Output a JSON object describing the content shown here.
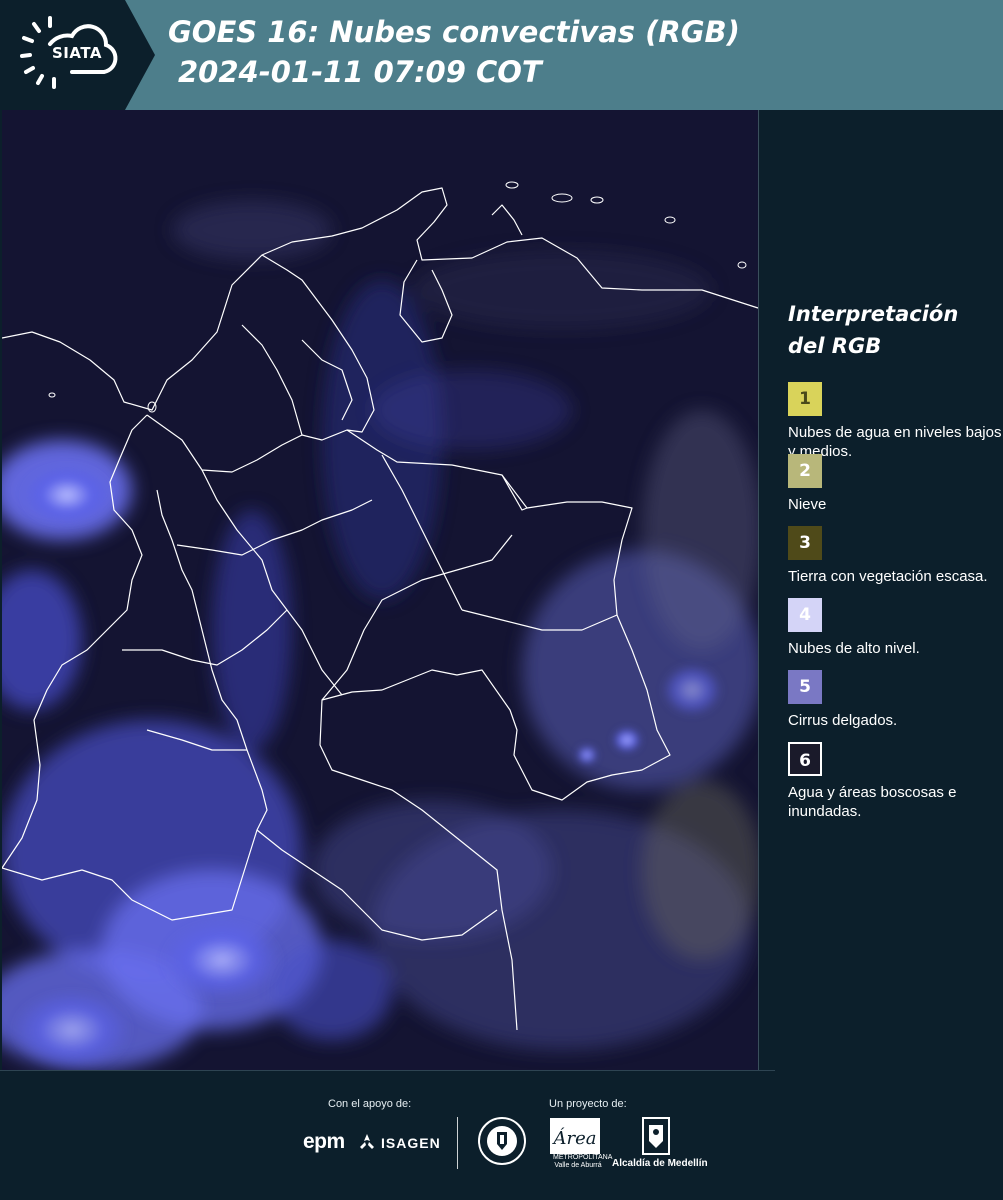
{
  "header": {
    "logo_text": "SIATA",
    "title_line1": "GOES 16: Nubes convectivas (RGB)",
    "title_line2": "2024-01-11 07:09 COT"
  },
  "legend": {
    "title_line1": "Interpretación",
    "title_line2": "del RGB",
    "items": [
      {
        "number": "1",
        "label": "Nubes de agua en niveles bajos y medios.",
        "color": "#d9d35a",
        "text_color": "#4a4a1a"
      },
      {
        "number": "2",
        "label": "Nieve",
        "color": "#b8b77a",
        "text_color": "#ffffff"
      },
      {
        "number": "3",
        "label": "Tierra con vegetación escasa.",
        "color": "#4f4a19",
        "text_color": "#ffffff"
      },
      {
        "number": "4",
        "label": "Nubes de alto nivel.",
        "color": "#d4d4f7",
        "text_color": "#ffffff"
      },
      {
        "number": "5",
        "label": "Cirrus delgados.",
        "color": "#7a78c4",
        "text_color": "#ffffff"
      },
      {
        "number": "6",
        "label": "Agua y áreas boscosas e inundadas.",
        "color": "#1a1a2a",
        "text_color": "#ffffff"
      }
    ]
  },
  "footer": {
    "support_label": "Con el apoyo de:",
    "project_label": "Un proyecto de:",
    "sponsor_epm": "epm",
    "sponsor_isagen": "ISAGEN",
    "area_logo_text": "Área",
    "area_sub_text": "METROPOLITANA Valle de Aburrá",
    "alcaldia_text": "Alcaldía de Medellín"
  },
  "colors": {
    "header_bg": "#4d7e8b",
    "page_bg": "#0c1f2b",
    "map_dark": "#141432",
    "cloud_blue": "#5b62e8"
  }
}
